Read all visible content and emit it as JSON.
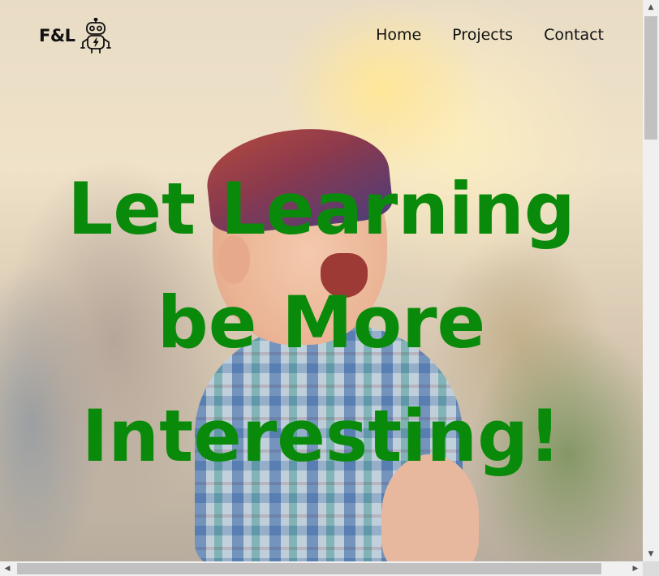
{
  "logo": {
    "text": "F&L",
    "icon": "robot-icon"
  },
  "nav": {
    "items": [
      {
        "label": "Home"
      },
      {
        "label": "Projects"
      },
      {
        "label": "Contact"
      }
    ]
  },
  "hero": {
    "headline_lines": [
      "Let Learning",
      "be More",
      "Interesting!"
    ],
    "headline_color": "#0a8a0a"
  },
  "scrollbars": {
    "up_icon": "arrow-up-icon",
    "down_icon": "arrow-down-icon",
    "left_icon": "arrow-left-icon",
    "right_icon": "arrow-right-icon"
  }
}
